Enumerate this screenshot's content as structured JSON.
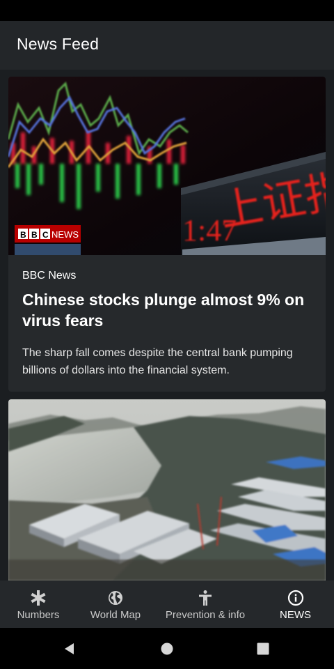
{
  "app_bar": {
    "title": "News Feed"
  },
  "articles": [
    {
      "image_badge": "NEWS",
      "image_overlay_text": "上证指数",
      "image_overlay_time": "1:47",
      "source": "BBC News",
      "headline": "Chinese stocks plunge almost 9% on virus fears",
      "summary": "The sharp fall comes despite the central bank pumping billions of dollars into the financial system."
    },
    {
      "image_description_icon": "aerial-construction-image"
    }
  ],
  "bottom_nav": {
    "items": [
      {
        "label": "Numbers",
        "icon": "asterisk-icon",
        "active": false
      },
      {
        "label": "World Map",
        "icon": "globe-icon",
        "active": false
      },
      {
        "label": "Prevention & info",
        "icon": "person-icon",
        "active": false
      },
      {
        "label": "NEWS",
        "icon": "info-icon",
        "active": true
      }
    ]
  },
  "system_nav": {
    "back": "back-icon",
    "home": "home-icon",
    "recents": "recents-icon"
  },
  "colors": {
    "background": "#1b1e21",
    "card": "#26292c",
    "app_bar": "#232629",
    "bbc_red": "#b80000",
    "ticker_red": "#e4221b"
  }
}
